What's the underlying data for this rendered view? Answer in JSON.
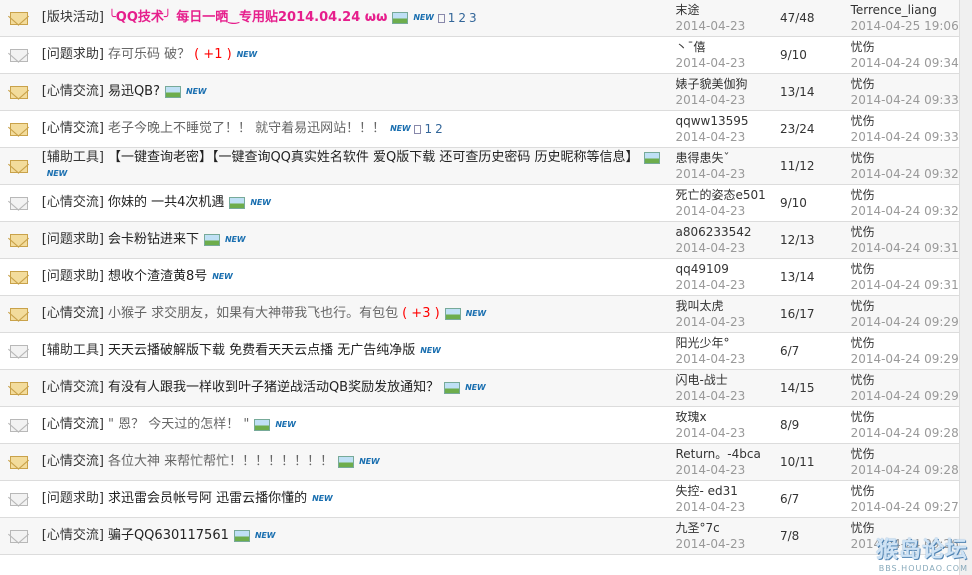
{
  "threads": [
    {
      "icon": "folder-icon",
      "category": "[版块活动]",
      "title": "╰QQ技术╯ 每日一晒‿专用贴2014.04.24   ωω",
      "style": "pink",
      "bonus": "",
      "has_image": true,
      "has_new": true,
      "pages": [
        "1",
        "2",
        "3"
      ],
      "author": "末途",
      "author_date": "2014-04-23",
      "count": "47/48",
      "last_user": "Terrence_liang",
      "last_date": "2014-04-25 19:06"
    },
    {
      "icon": "envelope-icon",
      "category": "[问题求助]",
      "title": "存可乐码  破？",
      "style": "grey",
      "bonus": "( +1 )",
      "has_image": false,
      "has_new": true,
      "pages": [],
      "author": "丶ˉ僖",
      "author_date": "2014-04-23",
      "count": "9/10",
      "last_user": "忧伤",
      "last_date": "2014-04-24 09:34"
    },
    {
      "icon": "folder-icon",
      "category": "[心情交流]",
      "title": "易迅QB?",
      "style": "normal",
      "bonus": "",
      "has_image": true,
      "has_new": true,
      "pages": [],
      "author": "婊子貌美伽狗",
      "author_date": "2014-04-23",
      "count": "13/14",
      "last_user": "忧伤",
      "last_date": "2014-04-24 09:33"
    },
    {
      "icon": "folder-icon",
      "category": "[心情交流]",
      "title": "老子今晚上不睡觉了！！ 就守着易迅网站！！！",
      "style": "grey",
      "bonus": "",
      "has_image": false,
      "has_new": true,
      "pages": [
        "1",
        "2"
      ],
      "author": "qqww13595",
      "author_date": "2014-04-23",
      "count": "23/24",
      "last_user": "忧伤",
      "last_date": "2014-04-24 09:33"
    },
    {
      "icon": "folder-icon",
      "category": "[辅助工具]",
      "title": "【一键查询老密】【一键查询QQ真实姓名软件 爱Q版下载 还可查历史密码 历史昵称等信息】",
      "style": "normal",
      "bonus": "",
      "has_image": true,
      "has_new": true,
      "pages": [],
      "author": "患得患失ˇ",
      "author_date": "2014-04-23",
      "count": "11/12",
      "last_user": "忧伤",
      "last_date": "2014-04-24 09:32"
    },
    {
      "icon": "envelope-icon",
      "category": "[心情交流]",
      "title": "你妹的  一共4次机遇",
      "style": "normal",
      "bonus": "",
      "has_image": true,
      "has_new": true,
      "pages": [],
      "author": "死亡的姿态e501",
      "author_date": "2014-04-23",
      "count": "9/10",
      "last_user": "忧伤",
      "last_date": "2014-04-24 09:32"
    },
    {
      "icon": "folder-icon",
      "category": "[问题求助]",
      "title": "会卡粉钻进来下",
      "style": "normal",
      "bonus": "",
      "has_image": true,
      "has_new": true,
      "pages": [],
      "author": "a806233542",
      "author_date": "2014-04-23",
      "count": "12/13",
      "last_user": "忧伤",
      "last_date": "2014-04-24 09:31"
    },
    {
      "icon": "folder-icon",
      "category": "[问题求助]",
      "title": "想收个渣渣黄8号",
      "style": "normal",
      "bonus": "",
      "has_image": false,
      "has_new": true,
      "pages": [],
      "author": "qq49109",
      "author_date": "2014-04-23",
      "count": "13/14",
      "last_user": "忧伤",
      "last_date": "2014-04-24 09:31"
    },
    {
      "icon": "folder-icon",
      "category": "[心情交流]",
      "title": "小猴子 求交朋友，如果有大神带我飞也行。有包包",
      "style": "grey",
      "bonus": "( +3 )",
      "has_image": true,
      "has_new": true,
      "pages": [],
      "author": "我叫太虎",
      "author_date": "2014-04-23",
      "count": "16/17",
      "last_user": "忧伤",
      "last_date": "2014-04-24 09:29"
    },
    {
      "icon": "envelope-icon",
      "category": "[辅助工具]",
      "title": "天天云播破解版下载 免费看天天云点播 无广告纯净版",
      "style": "normal",
      "bonus": "",
      "has_image": false,
      "has_new": true,
      "pages": [],
      "author": "阳光少年°",
      "author_date": "2014-04-23",
      "count": "6/7",
      "last_user": "忧伤",
      "last_date": "2014-04-24 09:29"
    },
    {
      "icon": "folder-icon",
      "category": "[心情交流]",
      "title": "有没有人跟我一样收到叶子猪逆战活动QB奖励发放通知？",
      "style": "normal",
      "bonus": "",
      "has_image": true,
      "has_new": true,
      "pages": [],
      "author": "闪电-战士",
      "author_date": "2014-04-23",
      "count": "14/15",
      "last_user": "忧伤",
      "last_date": "2014-04-24 09:29"
    },
    {
      "icon": "envelope-icon",
      "category": "[心情交流]",
      "title": "\" 恩？ 今天过的怎样！ \"",
      "style": "grey",
      "bonus": "",
      "has_image": true,
      "has_new": true,
      "pages": [],
      "author": "玫瑰x",
      "author_date": "2014-04-23",
      "count": "8/9",
      "last_user": "忧伤",
      "last_date": "2014-04-24 09:28"
    },
    {
      "icon": "folder-icon",
      "category": "[心情交流]",
      "title": "各位大神 来帮忙帮忙！！！！！！！！",
      "style": "grey",
      "bonus": "",
      "has_image": true,
      "has_new": true,
      "pages": [],
      "author": "Return。-4bca",
      "author_date": "2014-04-23",
      "count": "10/11",
      "last_user": "忧伤",
      "last_date": "2014-04-24 09:28"
    },
    {
      "icon": "envelope-icon",
      "category": "[问题求助]",
      "title": "求迅雷会员帐号阿 迅雷云播你懂的",
      "style": "normal",
      "bonus": "",
      "has_image": false,
      "has_new": true,
      "pages": [],
      "author": "失控-     ed31",
      "author_date": "2014-04-23",
      "count": "6/7",
      "last_user": "忧伤",
      "last_date": "2014-04-24 09:27"
    },
    {
      "icon": "envelope-icon",
      "category": "[心情交流]",
      "title": "骗子QQ630117561",
      "style": "normal",
      "bonus": "",
      "has_image": true,
      "has_new": true,
      "pages": [],
      "author": "九圣°7c",
      "author_date": "2014-04-23",
      "count": "7/8",
      "last_user": "忧伤",
      "last_date": "2014-04-24 09:26"
    }
  ],
  "watermark": {
    "text": "猴岛论坛",
    "url": "BBS.HOUDAO.COM"
  },
  "labels": {
    "new": "NEW"
  },
  "colors": {
    "accent_title": "#e61e8c",
    "bonus": "#ff0000",
    "date": "#999999"
  }
}
